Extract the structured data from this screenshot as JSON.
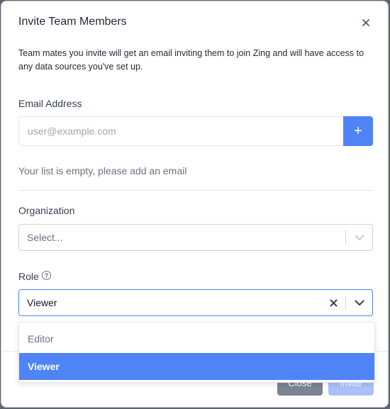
{
  "dialog": {
    "title": "Invite Team Members",
    "close_icon": "close-icon",
    "description": "Team mates you invite will get an email inviting them to join Zing and will have access to any data sources you've set up."
  },
  "email": {
    "label": "Email Address",
    "placeholder": "user@example.com",
    "value": "",
    "add_button": "+",
    "empty_message": "Your list is empty, please add an email"
  },
  "organization": {
    "label": "Organization",
    "placeholder": "Select..."
  },
  "role": {
    "label": "Role",
    "help_icon": "question-circle-icon",
    "selected": "Viewer",
    "options": [
      "Editor",
      "Viewer"
    ]
  },
  "footer": {
    "close_label": "Close",
    "invite_label": "Invite"
  },
  "colors": {
    "primary": "#4f84f7",
    "primary_disabled": "#a8c1fa",
    "secondary": "#7b8493"
  }
}
